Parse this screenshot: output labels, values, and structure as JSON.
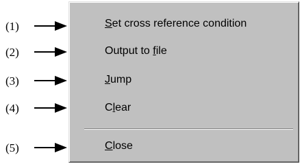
{
  "callouts": [
    {
      "label": "(1)"
    },
    {
      "label": "(2)"
    },
    {
      "label": "(3)"
    },
    {
      "label": "(4)"
    },
    {
      "label": "(5)"
    }
  ],
  "menu": {
    "items": [
      {
        "mnemonic": "S",
        "rest": "et cross reference condition"
      },
      {
        "pre": "Output to ",
        "mnemonic": "f",
        "rest": "ile"
      },
      {
        "mnemonic": "J",
        "rest": "ump"
      },
      {
        "pre": "C",
        "mnemonic": "l",
        "rest": "ear"
      },
      {
        "mnemonic": "C",
        "rest": "lose"
      }
    ]
  }
}
